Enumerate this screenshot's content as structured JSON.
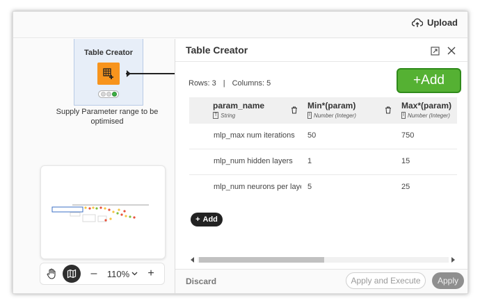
{
  "topbar": {
    "upload_label": "Upload",
    "upload_icon": "cloud-upload-icon"
  },
  "canvas": {
    "node": {
      "title": "Table Creator",
      "caption": "Supply Parameter range to be optimised",
      "icon": "table-add-icon",
      "status_colors": [
        "#d8d8d8",
        "#d8d8d8",
        "#3cb043"
      ]
    },
    "zoom": {
      "level": "110%",
      "minus": "–",
      "plus": "+"
    }
  },
  "panel": {
    "title": "Table Creator",
    "summary": {
      "rows": "Rows: 3",
      "separator": "|",
      "columns": "Columns: 5"
    },
    "add_big_label": "+Add",
    "add_small_label": "Add",
    "columns": [
      {
        "title": "param_name",
        "type": "String",
        "type_icon": "T"
      },
      {
        "title": "Min*(param)",
        "type": "Number (Integer)",
        "type_icon": "I"
      },
      {
        "title": "Max*(param)",
        "type": "Number (Integer)",
        "type_icon": "I"
      }
    ],
    "rows": [
      [
        "mlp_max num iterations",
        "50",
        "750"
      ],
      [
        "mlp_num hidden layers",
        "1",
        "15"
      ],
      [
        "mlp_num neurons per layer",
        "5",
        "25"
      ]
    ],
    "footer": {
      "discard": "Discard",
      "apply_execute": "Apply and Execute",
      "apply": "Apply"
    }
  },
  "colors": {
    "accent_green": "#55b133",
    "node_orange": "#f7941d",
    "node_bg": "#e7eef8"
  }
}
